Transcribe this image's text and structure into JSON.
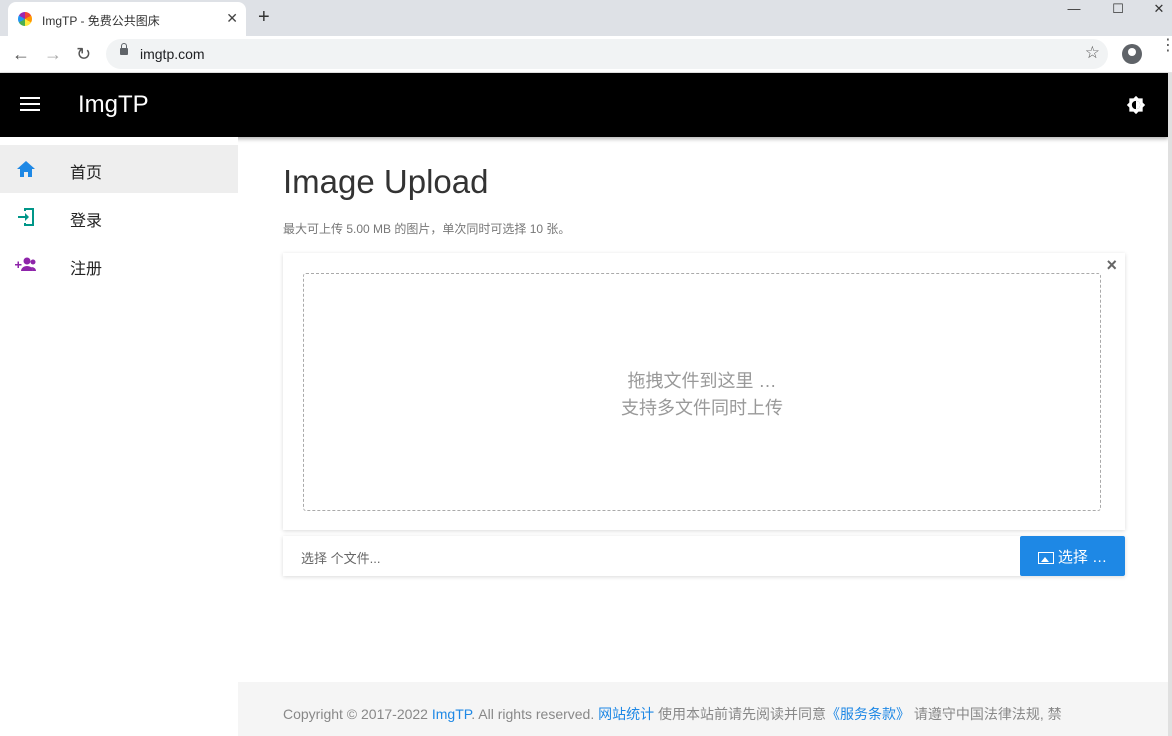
{
  "browser": {
    "tab_title": "ImgTP - 免费公共图床",
    "tab_close": "✕",
    "new_tab": "+",
    "url": "imgtp.com",
    "window_controls": [
      "—",
      "☐",
      "✕"
    ]
  },
  "header": {
    "brand": "ImgTP",
    "menu_icon": "hamburger-icon",
    "theme_icon": "brightness-icon"
  },
  "sidebar": {
    "items": [
      {
        "label": "首页",
        "icon": "home-icon",
        "color": "#1e88e5",
        "active": true
      },
      {
        "label": "登录",
        "icon": "login-icon",
        "color": "#009688",
        "active": false
      },
      {
        "label": "注册",
        "icon": "add-user-icon",
        "color": "#8e24aa",
        "active": false
      }
    ]
  },
  "main": {
    "title": "Image Upload",
    "subtitle": "最大可上传 5.00 MB 的图片，单次同时可选择 10 张。",
    "dropzone_line1": "拖拽文件到这里 …",
    "dropzone_line2": "支持多文件同时上传",
    "close": "×",
    "file_caption": "选择 个文件...",
    "choose_label": "选择 …"
  },
  "footer": {
    "copyright": "Copyright © 2017-2022 ",
    "brand_link": "ImgTP",
    "rights": ". All rights reserved. ",
    "stats_link": "网站统计",
    "notice": " 使用本站前请先阅读并同意",
    "terms_link": "《服务条款》",
    "tail": " 请遵守中国法律法规, 禁"
  },
  "colors": {
    "accent": "#1e88e5",
    "header_bg": "#000000"
  }
}
